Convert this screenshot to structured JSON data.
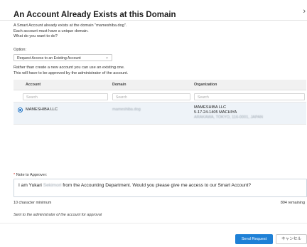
{
  "dialog": {
    "title": "An Account Already Exists at this Domain",
    "close_glyph": "›",
    "intro_line1": "A Smart Account already exists at the domain \"mameshiba.dog\".",
    "intro_line2": "Each account must have a unique domain.",
    "intro_line3": "What do you want to do?"
  },
  "option": {
    "label": "Option:",
    "selected": "Request Access to an Existing Account",
    "caret_glyph": "⌄"
  },
  "rather": {
    "line1": "Rather than create a new account you can use an existing one.",
    "line2": "This will have to be approved by the administrator of the account."
  },
  "table": {
    "columns": [
      "Account",
      "Domain",
      "Organization"
    ],
    "filter_placeholders": [
      "Search",
      "Search",
      "Search"
    ],
    "rows": [
      {
        "account": "MAMESHIBA LLC",
        "domain": "mameshiba.dog",
        "org_line1": "MAMESHIBA LLC",
        "org_line2": "5-17-24-1405 MACHIYA",
        "org_line3": "ARAKAWA, TOKYO, 116-0001, JAPAN"
      }
    ]
  },
  "note": {
    "required_mark": "*",
    "label": "Note to Approver:",
    "text_before": "I am Yukari ",
    "text_name": "Sekimori",
    "text_after": " from the Accounting Department. Would you please give me access to our Smart Account?",
    "min_text": "10 character minimum",
    "remaining_text": "894 remaining"
  },
  "sent_text": "Sent to the administrator of the account for approval",
  "footer": {
    "primary_label": "Send Request",
    "cancel_label": "キャンセル"
  },
  "colors": {
    "accent": "#1e80d6",
    "required": "#d02b20",
    "row_highlight": "#eef3f8"
  }
}
